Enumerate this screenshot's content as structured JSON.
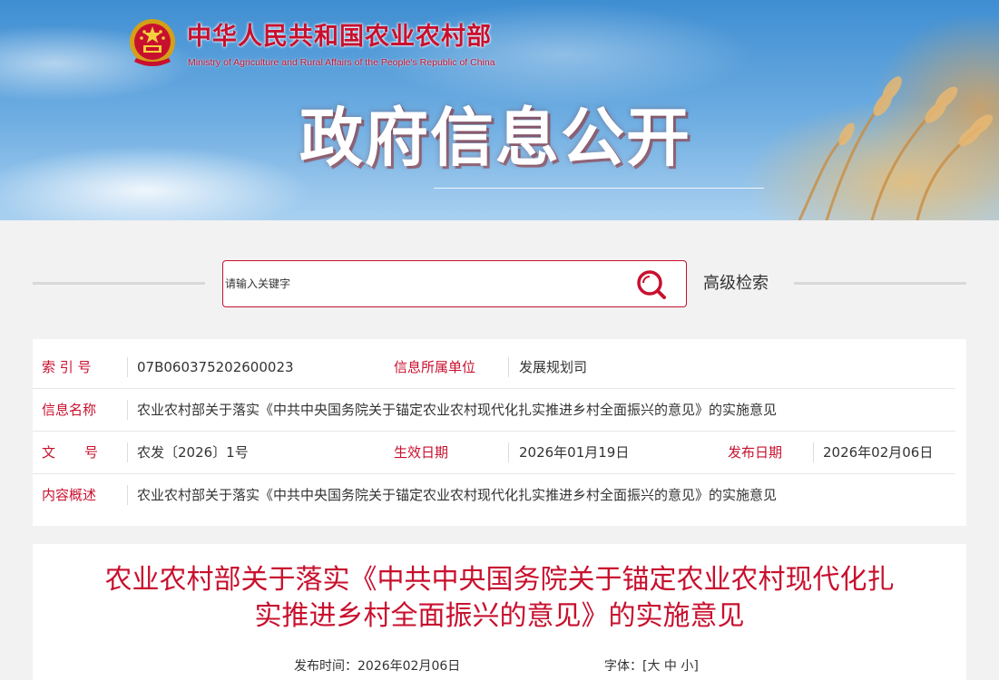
{
  "header": {
    "site_name_cn": "中华人民共和国农业农村部",
    "site_name_en": "Ministry of Agriculture and Rural Affairs of the People's Republic of China",
    "banner_title": "政府信息公开",
    "emblem_icon": "national-emblem-icon",
    "colors": {
      "brand_red": "#c8102e",
      "sky_blue": "#4a96d8",
      "wheat_gold": "#e0b070"
    }
  },
  "search": {
    "placeholder": "请输入关键字",
    "button_icon": "search-icon",
    "advanced_label": "高级检索"
  },
  "info_table": {
    "index_label": "索 引 号",
    "index_value": "07B060375202600023",
    "unit_label": "信息所属单位",
    "unit_value": "发展规划司",
    "name_label": "信息名称",
    "name_value": "农业农村部关于落实《中共中央国务院关于锚定农业农村现代化扎实推进乡村全面振兴的意见》的实施意见",
    "doc_no_label_1": "文",
    "doc_no_label_2": "号",
    "doc_no_value": "农发〔2026〕1号",
    "effective_label": "生效日期",
    "effective_value": "2026年01月19日",
    "publish_label": "发布日期",
    "publish_value": "2026年02月06日",
    "summary_label": "内容概述",
    "summary_value": "农业农村部关于落实《中共中央国务院关于锚定农业农村现代化扎实推进乡村全面振兴的意见》的实施意见"
  },
  "article": {
    "title_line1": "农业农村部关于落实《中共中央国务院关于锚定农业农村现代化扎",
    "title_line2": "实推进乡村全面振兴的意见》的实施意见",
    "publish_time_label": "发布时间：",
    "publish_time_value": "2026年02月06日",
    "font_label": "字体：",
    "font_open": "[",
    "font_large": "大",
    "font_medium": "中",
    "font_small": "小",
    "font_close": "]"
  }
}
